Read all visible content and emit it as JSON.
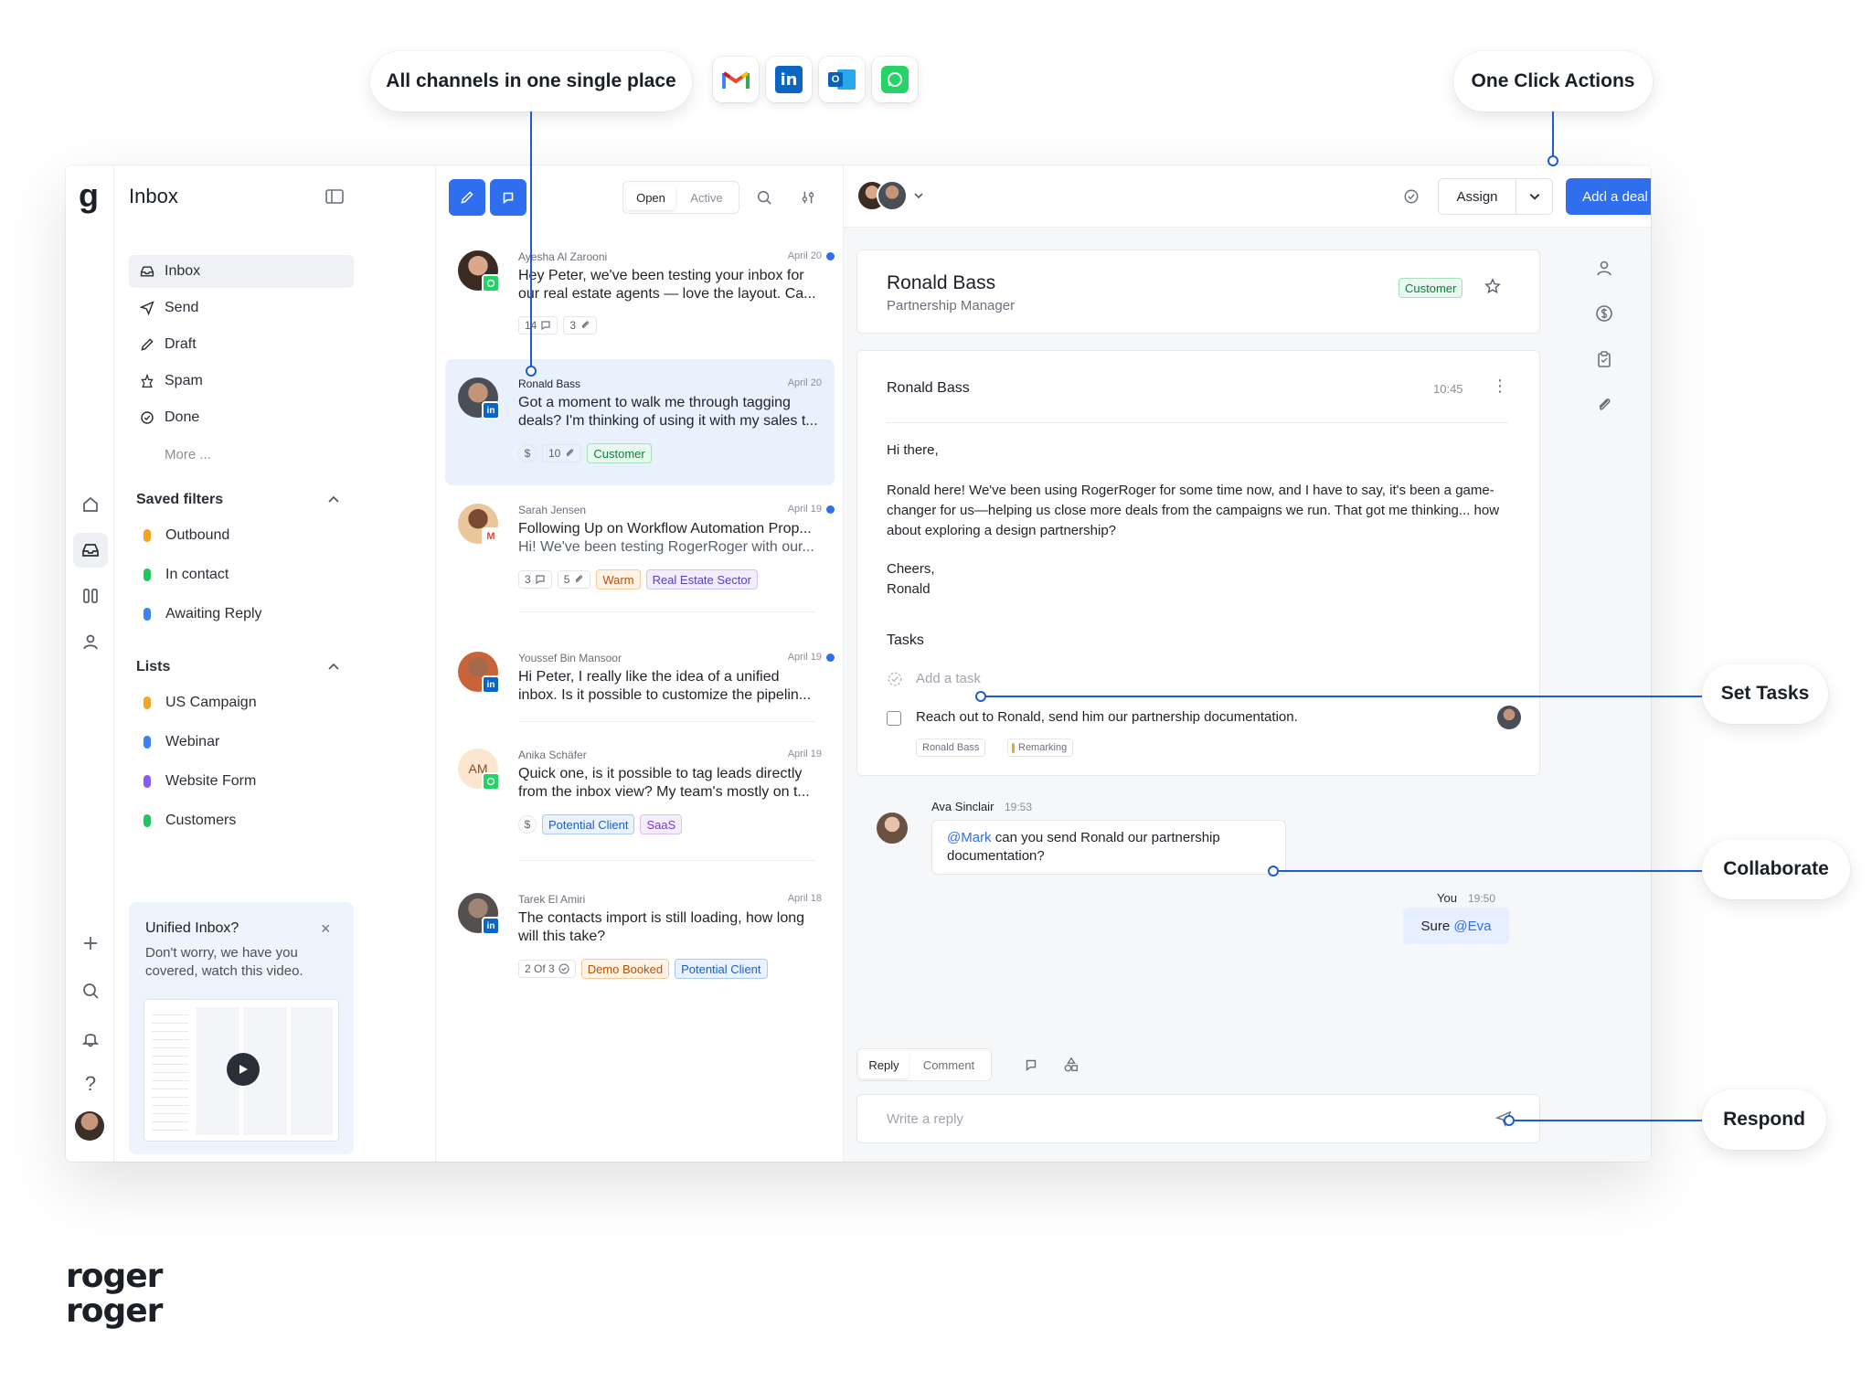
{
  "callouts": {
    "channels": "All channels in one single place",
    "one_click": "One Click Actions",
    "set_tasks": "Set Tasks",
    "collaborate": "Collaborate",
    "respond": "Respond"
  },
  "channel_icons": [
    "gmail-icon",
    "linkedin-icon",
    "outlook-icon",
    "whatsapp-icon"
  ],
  "brand": {
    "line1": "roger",
    "line2": "roger",
    "logo_letter": "g"
  },
  "sidebar": {
    "title": "Inbox",
    "nav": [
      {
        "label": "Inbox",
        "icon": "inbox-icon"
      },
      {
        "label": "Send",
        "icon": "send-icon"
      },
      {
        "label": "Draft",
        "icon": "pencil-icon"
      },
      {
        "label": "Spam",
        "icon": "spam-icon"
      },
      {
        "label": "Done",
        "icon": "check-circle-icon"
      }
    ],
    "more": "More ...",
    "saved_filters_title": "Saved filters",
    "saved_filters": [
      {
        "label": "Outbound",
        "color": "#f5a524"
      },
      {
        "label": "In contact",
        "color": "#22c55e"
      },
      {
        "label": "Awaiting Reply",
        "color": "#3b82f6"
      }
    ],
    "lists_title": "Lists",
    "lists": [
      {
        "label": "US Campaign",
        "color": "#f5a524"
      },
      {
        "label": "Webinar",
        "color": "#3b82f6"
      },
      {
        "label": "Website Form",
        "color": "#8b5cf6"
      },
      {
        "label": "Customers",
        "color": "#22c55e"
      }
    ],
    "promo": {
      "title": "Unified Inbox?",
      "body": "Don't worry, we have you covered, watch this video."
    }
  },
  "list_header": {
    "tab_open": "Open",
    "tab_active": "Active"
  },
  "conversations": [
    {
      "name": "Ayesha Al Zarooni",
      "date": "April 20",
      "unread": true,
      "line1": "Hey Peter, we've been testing your inbox for",
      "line2": "our real estate agents — love the layout. Ca...",
      "comments": "14",
      "files": "3",
      "channel": "whatsapp"
    },
    {
      "name": "Ronald Bass",
      "date": "April 20",
      "unread": false,
      "line1": "Got a moment to walk me through tagging",
      "line2": "deals? I'm thinking of using it with my sales t...",
      "files": "10",
      "tag": "Customer",
      "channel": "linkedin"
    },
    {
      "name": "Sarah Jensen",
      "date": "April 19",
      "unread": true,
      "line1": "Following Up on Workflow Automation Prop...",
      "line2": "Hi! We've been testing RogerRoger with our...",
      "comments": "3",
      "files": "5",
      "tags": [
        "Warm",
        "Real Estate Sector"
      ],
      "channel": "gmail"
    },
    {
      "name": "Youssef Bin Mansoor",
      "date": "April 19",
      "unread": true,
      "line1": "Hi Peter, I really like the idea of a unified",
      "line2": "inbox. Is it possible to customize the pipelin...",
      "channel": "linkedin"
    },
    {
      "name": "Anika Schäfer",
      "initials": "AM",
      "date": "April 19",
      "unread": false,
      "line1": "Quick one, is it possible to tag leads directly",
      "line2": "from the inbox view? My team's mostly on t...",
      "tags": [
        "Potential Client",
        "SaaS"
      ],
      "channel": "whatsapp"
    },
    {
      "name": "Tarek El Amiri",
      "date": "April 18",
      "unread": false,
      "line1": "The contacts import is still loading, how long",
      "line2": "will this take?",
      "progress": "2 Of 3",
      "tags": [
        "Demo Booked",
        "Potential Client"
      ],
      "channel": "linkedin"
    }
  ],
  "toolbar": {
    "assign": "Assign",
    "add_deal": "Add a deal"
  },
  "contact": {
    "name": "Ronald Bass",
    "role": "Partnership Manager",
    "tag": "Customer"
  },
  "email": {
    "from": "Ronald Bass",
    "time": "10:45",
    "greeting": "Hi there,",
    "body": "Ronald here! We've been using RogerRoger for some time now, and I have to say, it's been a game-changer for us—helping us close more deals from the campaigns we run. That got me thinking... how about exploring a design partnership?",
    "signoff1": "Cheers,",
    "signoff2": "Ronald",
    "tasks_title": "Tasks",
    "add_task": "Add a task",
    "task": "Reach out to Ronald, send him our partnership documentation.",
    "task_contact": "Ronald Bass",
    "task_label": "Remarking"
  },
  "comments": {
    "c1_author": "Ava Sinclair",
    "c1_time": "19:53",
    "c1_mention": "@Mark",
    "c1_text": " can you send Ronald our partnership documentation?",
    "c2_author": "You",
    "c2_time": "19:50",
    "c2_text": "Sure ",
    "c2_mention": "@Eva"
  },
  "composer": {
    "tab_reply": "Reply",
    "tab_comment": "Comment",
    "placeholder": "Write a reply"
  },
  "colors": {
    "accent": "#2f6fed",
    "connector": "#1e5bd6"
  }
}
